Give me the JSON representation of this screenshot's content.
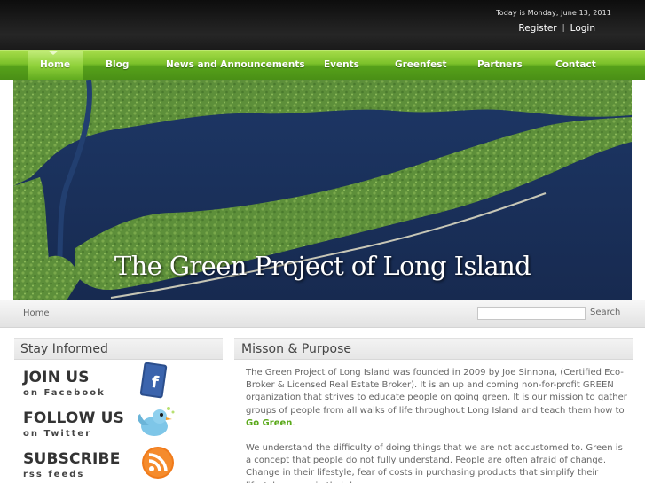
{
  "header": {
    "date_text": "Today is Monday, June 13, 2011",
    "register_label": "Register",
    "separator": "|",
    "login_label": "Login"
  },
  "nav": {
    "items": [
      {
        "label": "Home",
        "active": true
      },
      {
        "label": "Blog"
      },
      {
        "label": "News and Announcements"
      },
      {
        "label": "Events"
      },
      {
        "label": "Greenfest"
      },
      {
        "label": "Partners"
      },
      {
        "label": "Contact"
      }
    ]
  },
  "banner": {
    "title": "The Green Project of Long Island"
  },
  "breadcrumb": {
    "home": "Home"
  },
  "search": {
    "placeholder": "",
    "value": "",
    "button_label": "Search"
  },
  "sidebar": {
    "title": "Stay Informed",
    "promos": [
      {
        "big": "JOIN US",
        "small": "on Facebook",
        "icon": "facebook-icon"
      },
      {
        "big": "FOLLOW US",
        "small": "on Twitter",
        "icon": "twitter-bird-icon"
      },
      {
        "big": "SUBSCRIBE",
        "small": "rss feeds",
        "icon": "rss-feed-icon"
      }
    ]
  },
  "main": {
    "title": "Misson & Purpose",
    "paragraph1_text": "The Green Project of Long Island was founded in 2009 by Joe Sinnona, (Certified Eco-Broker & Licensed Real Estate Broker). It is an up and coming non-for-profit GREEN organization that strives to educate people on going green. It is our mission to gather groups of people from all walks of life throughout Long Island and teach them how to",
    "paragraph1_link": "Go Green",
    "paragraph1_end": ".",
    "paragraph2": "We understand the difficulty of doing things that we are not accustomed to. Green is a concept that people do not fully understand. People are often afraid of change. Change in their lifestyle, fear of costs in purchasing products that simplify their lifestyles, even in their homes."
  },
  "colors": {
    "nav_green": "#7cc12a",
    "link_green": "#5aa91a",
    "topbar_dark": "#1a1a1a"
  }
}
